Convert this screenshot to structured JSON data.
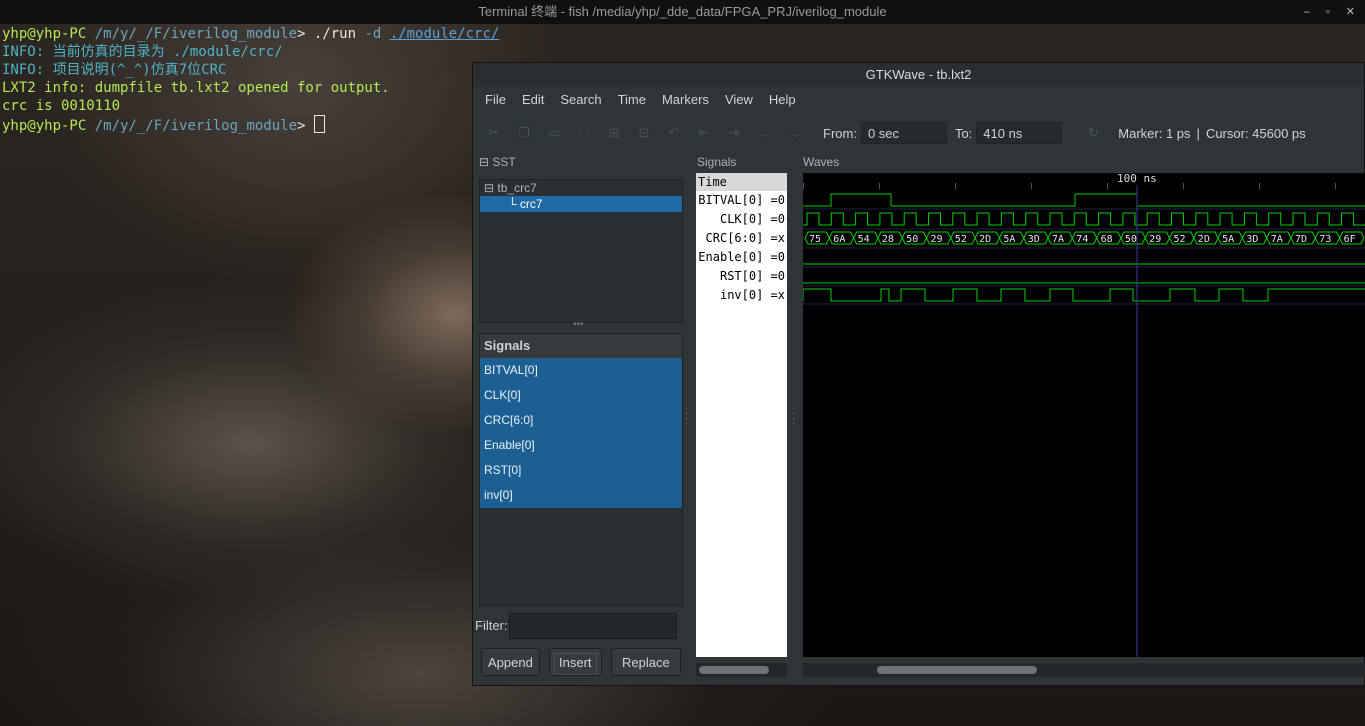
{
  "terminal": {
    "title": "Terminal 终端 - fish /media/yhp/_dde_data/FPGA_PRJ/iverilog_module",
    "window_controls": [
      "–",
      "▫",
      "✕"
    ],
    "lines": [
      {
        "prompt_user": "yhp@yhp-PC",
        "prompt_path": " /m/y/_/F/iverilog_module",
        "prompt_sym": "> ",
        "cmd": "./run",
        "arg": " -d ",
        "path": "./module/crc/"
      },
      {
        "text": "INFO: 当前仿真的目录为 ./module/crc/"
      },
      {
        "text": "INFO: 项目说明(^_^)仿真7位CRC"
      },
      {
        "text": "LXT2 info: dumpfile tb.lxt2 opened for output."
      },
      {
        "text": "crc is 0010110"
      },
      {
        "prompt_user": "yhp@yhp-PC",
        "prompt_path": " /m/y/_/F/iverilog_module",
        "prompt_sym": "> "
      }
    ]
  },
  "gtkwave": {
    "title": "GTKWave - tb.lxt2",
    "menu": [
      "File",
      "Edit",
      "Search",
      "Time",
      "Markers",
      "View",
      "Help"
    ],
    "toolbar": {
      "from_label": "From:",
      "from_value": "0 sec",
      "to_label": "To:",
      "to_value": "410 ns",
      "marker": "Marker: 1 ps",
      "sep": "|",
      "cursor": "Cursor: 45600 ps"
    },
    "sst": {
      "label": "SST",
      "tree": [
        "tb_crc7",
        "crc7"
      ],
      "signals_header": "Signals",
      "signals": [
        "BITVAL[0]",
        "CLK[0]",
        "CRC[6:0]",
        "Enable[0]",
        "RST[0]",
        "inv[0]"
      ],
      "filter_label": "Filter:",
      "buttons": {
        "append": "Append",
        "insert": "Insert",
        "replace": "Replace"
      }
    },
    "signals_pane": {
      "label": "Signals",
      "time_header": "Time",
      "rows": [
        "BITVAL[0] =0",
        "CLK[0] =0",
        "CRC[6:0] =x",
        "Enable[0] =0",
        "RST[0] =0",
        "inv[0] =x"
      ]
    },
    "waves": {
      "label": "Waves",
      "time_marker": "100 ns",
      "crc_values": [
        "75",
        "6A",
        "54",
        "28",
        "50",
        "29",
        "52",
        "2D",
        "5A",
        "3D",
        "7A",
        "74",
        "68",
        "50",
        "29",
        "52",
        "2D",
        "5A",
        "3D",
        "7A",
        "7D",
        "73",
        "6F"
      ],
      "wave_color": "#00d000"
    }
  }
}
